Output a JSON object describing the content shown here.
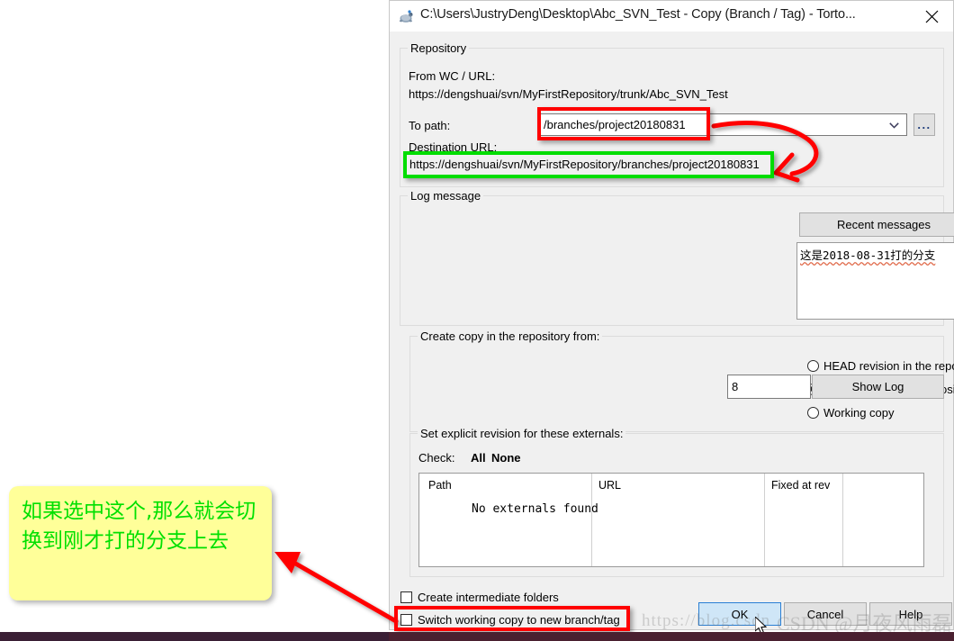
{
  "window": {
    "title": "C:\\Users\\JustryDeng\\Desktop\\Abc_SVN_Test - Copy (Branch / Tag) - Torto...",
    "icon": "tortoisesvn-turtle-icon",
    "close_label": "✕"
  },
  "repository": {
    "group_label": "Repository",
    "from_label": "From WC / URL:",
    "from_url": "https://dengshuai/svn/MyFirstRepository/trunk/Abc_SVN_Test",
    "to_path_label": "To path:",
    "to_path_value": "/branches/project20180831",
    "browse_label": "...",
    "destination_label": "Destination URL:",
    "destination_url": "https://dengshuai/svn/MyFirstRepository/branches/project20180831"
  },
  "log_message": {
    "group_label": "Log message",
    "recent_button": "Recent messages",
    "text": "这是2018-08-31打的分支"
  },
  "create_copy": {
    "group_label": "Create copy in the repository from:",
    "options": [
      {
        "label": "HEAD revision in the repository",
        "selected": false
      },
      {
        "label": "Specific revision in repository",
        "selected": true
      },
      {
        "label": "Working copy",
        "selected": false
      }
    ],
    "revision_value": "8",
    "show_log_button": "Show Log"
  },
  "externals": {
    "group_label": "Set explicit revision for these externals:",
    "check_label": "Check:",
    "check_all": "All",
    "check_none": "None",
    "columns": [
      "Path",
      "URL",
      "Fixed at rev"
    ],
    "empty_message": "No externals found",
    "rows": []
  },
  "footer": {
    "checkboxes": [
      {
        "label": "Create intermediate folders",
        "checked": false
      },
      {
        "label": "Switch working copy to new branch/tag",
        "checked": false
      }
    ],
    "ok_label": "OK",
    "cancel_label": "Cancel",
    "help_label": "Help"
  },
  "annotations": {
    "note_text": "如果选中这个,那么就会切换到刚才打的分支上去",
    "note_color": "#ffff99",
    "note_text_color": "#00e000",
    "highlight_red": "#ff0000",
    "highlight_green": "#00dd00"
  },
  "watermark": {
    "url": "https://blog.csdn",
    "csdn": "CSDN @月夜风雨磊"
  }
}
